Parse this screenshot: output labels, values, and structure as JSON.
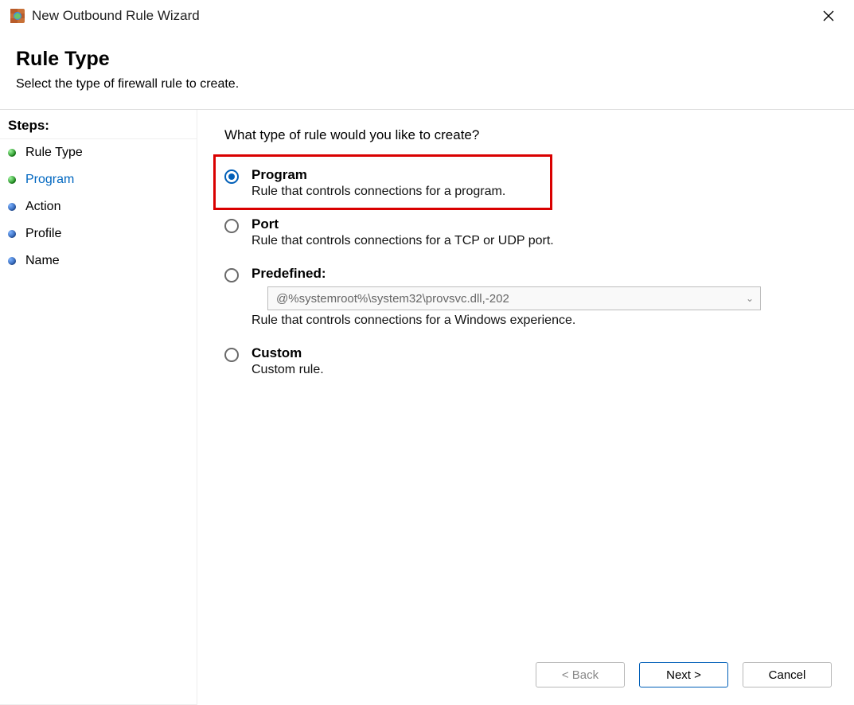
{
  "title": "New Outbound Rule Wizard",
  "header": {
    "heading": "Rule Type",
    "subheading": "Select the type of firewall rule to create."
  },
  "sidebar": {
    "heading": "Steps:",
    "steps": [
      {
        "label": "Rule Type",
        "bullet": "green",
        "active": false
      },
      {
        "label": "Program",
        "bullet": "green",
        "active": true
      },
      {
        "label": "Action",
        "bullet": "blue",
        "active": false
      },
      {
        "label": "Profile",
        "bullet": "blue",
        "active": false
      },
      {
        "label": "Name",
        "bullet": "blue",
        "active": false
      }
    ]
  },
  "main": {
    "prompt": "What type of rule would you like to create?",
    "options": {
      "program": {
        "title": "Program",
        "desc": "Rule that controls connections for a program."
      },
      "port": {
        "title": "Port",
        "desc": "Rule that controls connections for a TCP or UDP port."
      },
      "predefined": {
        "title": "Predefined:",
        "select_value": "@%systemroot%\\system32\\provsvc.dll,-202",
        "desc": "Rule that controls connections for a Windows experience."
      },
      "custom": {
        "title": "Custom",
        "desc": "Custom rule."
      }
    }
  },
  "footer": {
    "back": "< Back",
    "next": "Next >",
    "cancel": "Cancel"
  }
}
